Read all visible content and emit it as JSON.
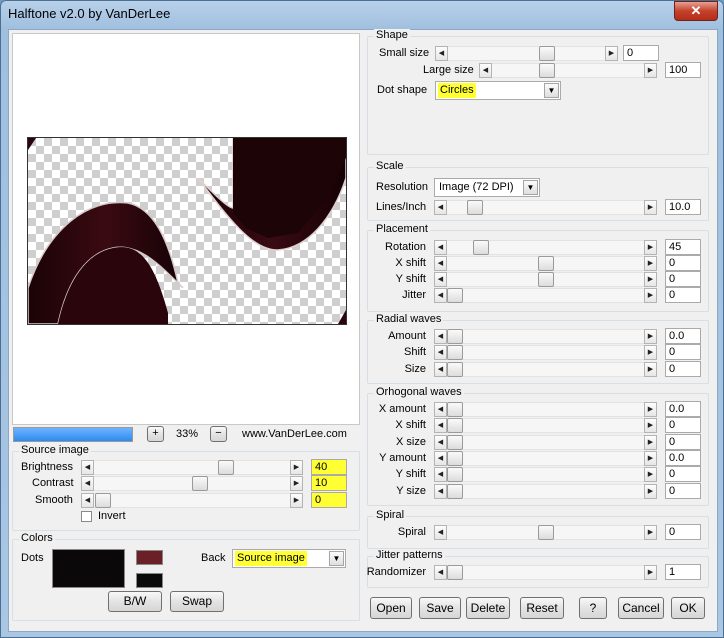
{
  "window": {
    "title": "Halftone v2.0 by VanDerLee",
    "close_glyph": "✕"
  },
  "preview": {
    "zoom": "33%",
    "zoom_in": "+",
    "zoom_out": "−",
    "website": "www.VanDerLee.com",
    "progress": 1.0
  },
  "source_image": {
    "title": "Source image",
    "brightness": {
      "label": "Brightness",
      "value": "40"
    },
    "contrast": {
      "label": "Contrast",
      "value": "10"
    },
    "smooth": {
      "label": "Smooth",
      "value": "0"
    },
    "invert_label": "Invert",
    "invert_checked": false
  },
  "colors": {
    "title": "Colors",
    "dots_label": "Dots",
    "back_label": "Back",
    "back_value": "Source image",
    "dots_color": "#0a0808",
    "swatch_top": "#6b1f26",
    "swatch_bottom": "#0a0a0a",
    "bw_label": "B/W",
    "swap_label": "Swap"
  },
  "shape": {
    "title": "Shape",
    "small_size": {
      "label": "Small size",
      "value": "0"
    },
    "large_size": {
      "label": "Large size",
      "value": "100"
    },
    "dot_shape": {
      "label": "Dot shape",
      "value": "Circles"
    }
  },
  "scale": {
    "title": "Scale",
    "resolution": {
      "label": "Resolution",
      "value": "Image (72 DPI)"
    },
    "lines_inch": {
      "label": "Lines/Inch",
      "value": "10.0"
    }
  },
  "placement": {
    "title": "Placement",
    "rotation": {
      "label": "Rotation",
      "value": "45"
    },
    "x_shift": {
      "label": "X shift",
      "value": "0"
    },
    "y_shift": {
      "label": "Y shift",
      "value": "0"
    },
    "jitter": {
      "label": "Jitter",
      "value": "0"
    }
  },
  "radial": {
    "title": "Radial waves",
    "amount": {
      "label": "Amount",
      "value": "0.0"
    },
    "shift": {
      "label": "Shift",
      "value": "0"
    },
    "size": {
      "label": "Size",
      "value": "0"
    }
  },
  "orho": {
    "title": "Orhogonal waves",
    "x_amount": {
      "label": "X amount",
      "value": "0.0"
    },
    "x_shift": {
      "label": "X shift",
      "value": "0"
    },
    "x_size": {
      "label": "X size",
      "value": "0"
    },
    "y_amount": {
      "label": "Y amount",
      "value": "0.0"
    },
    "y_shift": {
      "label": "Y shift",
      "value": "0"
    },
    "y_size": {
      "label": "Y size",
      "value": "0"
    }
  },
  "spiral": {
    "title": "Spiral",
    "spiral": {
      "label": "Spiral",
      "value": "0"
    }
  },
  "jitter_patterns": {
    "title": "Jitter patterns",
    "randomizer": {
      "label": "Randomizer",
      "value": "1"
    }
  },
  "buttons": {
    "open": "Open",
    "save": "Save",
    "delete": "Delete",
    "reset": "Reset",
    "help": "?",
    "cancel": "Cancel",
    "ok": "OK"
  },
  "glyphs": {
    "left": "◀",
    "right": "▶",
    "down": "▼"
  }
}
